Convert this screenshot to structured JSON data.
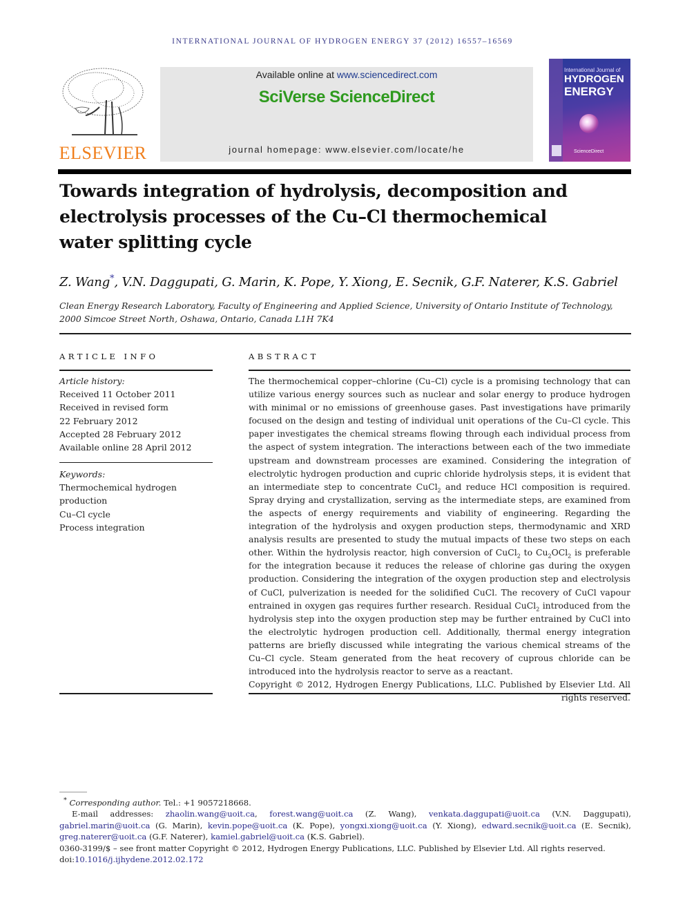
{
  "running_head": "International Journal of Hydrogen Energy 37 (2012) 16557–16569",
  "publisher": {
    "logo_word": "ELSEVIER",
    "logo_icon": "elsevier-tree-icon",
    "logo_color": "#f07f1c"
  },
  "banner": {
    "available_prefix": "Available online at ",
    "available_link": "www.sciencedirect.com",
    "brand": "SciVerse ScienceDirect",
    "brand_color": "#2e9a1e",
    "homepage": "journal homepage: www.elsevier.com/locate/he"
  },
  "cover": {
    "line1": "International Journal of",
    "line2": "HYDROGEN",
    "line3": "ENERGY",
    "footer": "ScienceDirect"
  },
  "article": {
    "title": "Towards integration of hydrolysis, decomposition and electrolysis processes of the Cu–Cl thermochemical water splitting cycle",
    "authors_first": "Z. Wang",
    "authors_star": "*",
    "authors_rest": ", V.N. Daggupati, G. Marin, K. Pope, Y. Xiong, E. Secnik, G.F. Naterer, K.S. Gabriel",
    "affiliation_line1": "Clean Energy Research Laboratory, Faculty of Engineering and Applied Science, University of Ontario Institute of Technology,",
    "affiliation_line2": "2000 Simcoe Street North, Oshawa, Ontario, Canada L1H 7K4"
  },
  "article_info": {
    "heading": "Article info",
    "history_label": "Article history:",
    "history": [
      "Received 11 October 2011",
      "Received in revised form",
      "22 February 2012",
      "Accepted 28 February 2012",
      "Available online 28 April 2012"
    ],
    "keywords_label": "Keywords:",
    "keywords": [
      "Thermochemical hydrogen",
      "production",
      "Cu–Cl cycle",
      "Process integration"
    ]
  },
  "abstract": {
    "heading": "Abstract",
    "p1": "The thermochemical copper–chlorine (Cu–Cl) cycle is a promising technology that can utilize various energy sources such as nuclear and solar energy to produce hydrogen with minimal or no emissions of greenhouse gases. Past investigations have primarily focused on the design and testing of individual unit operations of the Cu–Cl cycle. This paper investigates the chemical streams flowing through each individual process from the aspect of system integration. The interactions between each of the two immediate upstream and downstream processes are examined. Considering the integration of electrolytic hydrogen production and cupric chloride hydrolysis steps, it is evident that an intermediate step to concentrate CuCl",
    "p1_sub": "2",
    "p2": " and reduce HCl composition is required. Spray drying and crystalliza­tion, serving as the intermediate steps, are examined from the aspects of energy require­ments and viability of engineering. Regarding the integration of the hydrolysis and oxygen production steps, thermodynamic and XRD analysis results are presented to study the mutual impacts of these two steps on each other. Within the hydrolysis reactor, high conversion of CuCl",
    "p2_sub": "2",
    "p3": " to Cu",
    "p3_sub": "2",
    "p4": "OCl",
    "p4_sub": "2",
    "p5": " is preferable for the integration because it reduces the release of chlorine gas during the oxygen production. Considering the integration of the oxygen production step and electrolysis of CuCl, pulverization is needed for the solidified CuCl. The recovery of CuCl vapour entrained in oxygen gas requires further research. Residual CuCl",
    "p5_sub": "2",
    "p6": " introduced from the hydrolysis step into the oxygen production step may be further entrained by CuCl into the electrolytic hydrogen production cell. Additionally, thermal energy integration patterns are briefly discussed while integrating the various chemical streams of the Cu–Cl cycle. Steam generated from the heat recovery of cuprous chloride can be introduced into the hydrolysis reactor to serve as a reactant.",
    "copyright": "Copyright © 2012, Hydrogen Energy Publications, LLC. Published by Elsevier Ltd. All rights reserved."
  },
  "footnotes": {
    "star": "*",
    "corresponding_label": "Corresponding author.",
    "tel": " Tel.: +1 9057218668.",
    "email_label": "E-mail addresses: ",
    "emails": [
      {
        "addr": "zhaolin.wang@uoit.ca",
        "who": ", "
      },
      {
        "addr": "forest.wang@uoit.ca",
        "who": " (Z. Wang), "
      },
      {
        "addr": "venkata.daggupati@uoit.ca",
        "who": " (V.N. Daggupati), "
      },
      {
        "addr": "gabriel.marin@uoit.ca",
        "who": " (G. Marin), "
      },
      {
        "addr": "kevin.pope@uoit.ca",
        "who": " (K. Pope), "
      },
      {
        "addr": "yongxi.xiong@uoit.ca",
        "who": " (Y. Xiong), "
      },
      {
        "addr": "edward.secnik@uoit.ca",
        "who": " (E. Secnik), "
      },
      {
        "addr": "greg.naterer@uoit.ca",
        "who": " (G.F. Naterer), "
      },
      {
        "addr": "kamiel.gabriel@uoit.ca",
        "who": " (K.S. Gabriel)."
      }
    ],
    "front_matter": "0360-3199/$ – see front matter Copyright © 2012, Hydrogen Energy Publications, LLC. Published by Elsevier Ltd. All rights reserved.",
    "doi_label": "doi:",
    "doi": "10.1016/j.ijhydene.2012.02.172",
    "link_color": "#2b2b8c"
  }
}
